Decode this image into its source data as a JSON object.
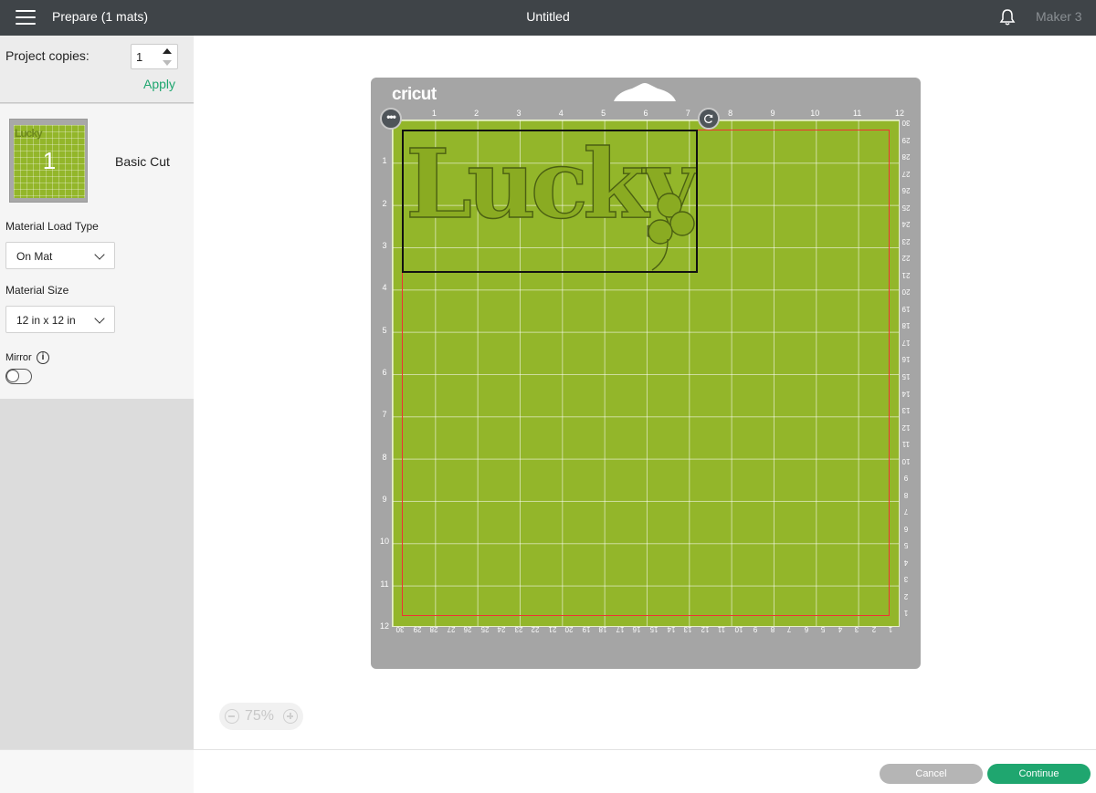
{
  "header": {
    "prepare_title": "Prepare (1 mats)",
    "project_title": "Untitled",
    "machine": "Maker 3"
  },
  "left_panel": {
    "copies_label": "Project copies:",
    "copies_value": "1",
    "apply_label": "Apply",
    "mat_number": "1",
    "mat_mini_text": "Lucky",
    "mat_name": "Basic Cut",
    "load_type_label": "Material Load Type",
    "load_type_value": "On Mat",
    "size_label": "Material Size",
    "size_value": "12 in x 12 in",
    "mirror_label": "Mirror",
    "mirror_on": false
  },
  "mat": {
    "brand": "cricut",
    "design_text": "Lucky",
    "top_ruler": [
      "1",
      "2",
      "3",
      "4",
      "5",
      "6",
      "7",
      "8",
      "9",
      "10",
      "11",
      "12"
    ],
    "left_ruler": [
      "1",
      "2",
      "3",
      "4",
      "5",
      "6",
      "7",
      "8",
      "9",
      "10",
      "11",
      "12"
    ],
    "right_ruler": [
      "30",
      "29",
      "28",
      "27",
      "26",
      "25",
      "24",
      "23",
      "22",
      "21",
      "20",
      "19",
      "18",
      "17",
      "16",
      "15",
      "14",
      "13",
      "12",
      "11",
      "10",
      "9",
      "8",
      "7",
      "6",
      "5",
      "4",
      "3",
      "2",
      "1"
    ],
    "bottom_ruler": [
      "30",
      "29",
      "28",
      "27",
      "26",
      "25",
      "24",
      "23",
      "22",
      "21",
      "20",
      "19",
      "18",
      "17",
      "16",
      "15",
      "14",
      "13",
      "12",
      "11",
      "10",
      "9",
      "8",
      "7",
      "6",
      "5",
      "4",
      "3",
      "2",
      "1"
    ],
    "colors": {
      "mat_green": "#93b62a",
      "mat_frame": "#a5a5a5",
      "cut_line": "#ee3333"
    }
  },
  "zoom": {
    "value": "75%"
  },
  "footer": {
    "cancel_label": "Cancel",
    "continue_label": "Continue"
  },
  "colors": {
    "accent": "#1fa66f",
    "topbar": "#3f4448"
  }
}
